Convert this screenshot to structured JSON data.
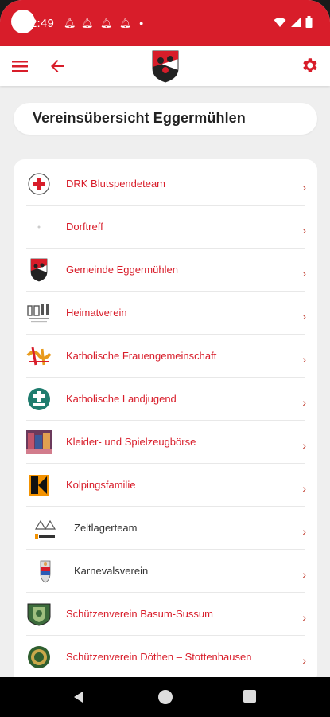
{
  "status": {
    "time": "2:49"
  },
  "header": {
    "title": "Vereinsübersicht Eggermühlen"
  },
  "clubs": [
    {
      "label": "DRK Blutspendeteam",
      "icon": "drk-logo-icon",
      "sub": false
    },
    {
      "label": "Dorftreff",
      "icon": "dorftreff-logo-icon",
      "sub": false
    },
    {
      "label": "Gemeinde Eggermühlen",
      "icon": "gemeinde-crest-icon",
      "sub": false
    },
    {
      "label": "Heimatverein",
      "icon": "heimatverein-logo-icon",
      "sub": false
    },
    {
      "label": "Katholische Frauengemeinschaft",
      "icon": "kfd-logo-icon",
      "sub": false
    },
    {
      "label": "Katholische Landjugend",
      "icon": "kljb-logo-icon",
      "sub": false
    },
    {
      "label": "Kleider- und Spielzeugbörse",
      "icon": "kleiderboerse-photo-icon",
      "sub": false
    },
    {
      "label": "Kolpingsfamilie",
      "icon": "kolping-logo-icon",
      "sub": false
    },
    {
      "label": "Zeltlagerteam",
      "icon": "zeltlager-logo-icon",
      "sub": true
    },
    {
      "label": "Karnevalsverein",
      "icon": "karneval-crest-icon",
      "sub": true
    },
    {
      "label": "Schützenverein Basum-Sussum",
      "icon": "schuetzen-basum-crest-icon",
      "sub": false
    },
    {
      "label": "Schützenverein Döthen – Stottenhausen",
      "icon": "schuetzen-doethen-crest-icon",
      "sub": false
    }
  ],
  "colors": {
    "primary": "#d81d2a",
    "background": "#efefef"
  }
}
